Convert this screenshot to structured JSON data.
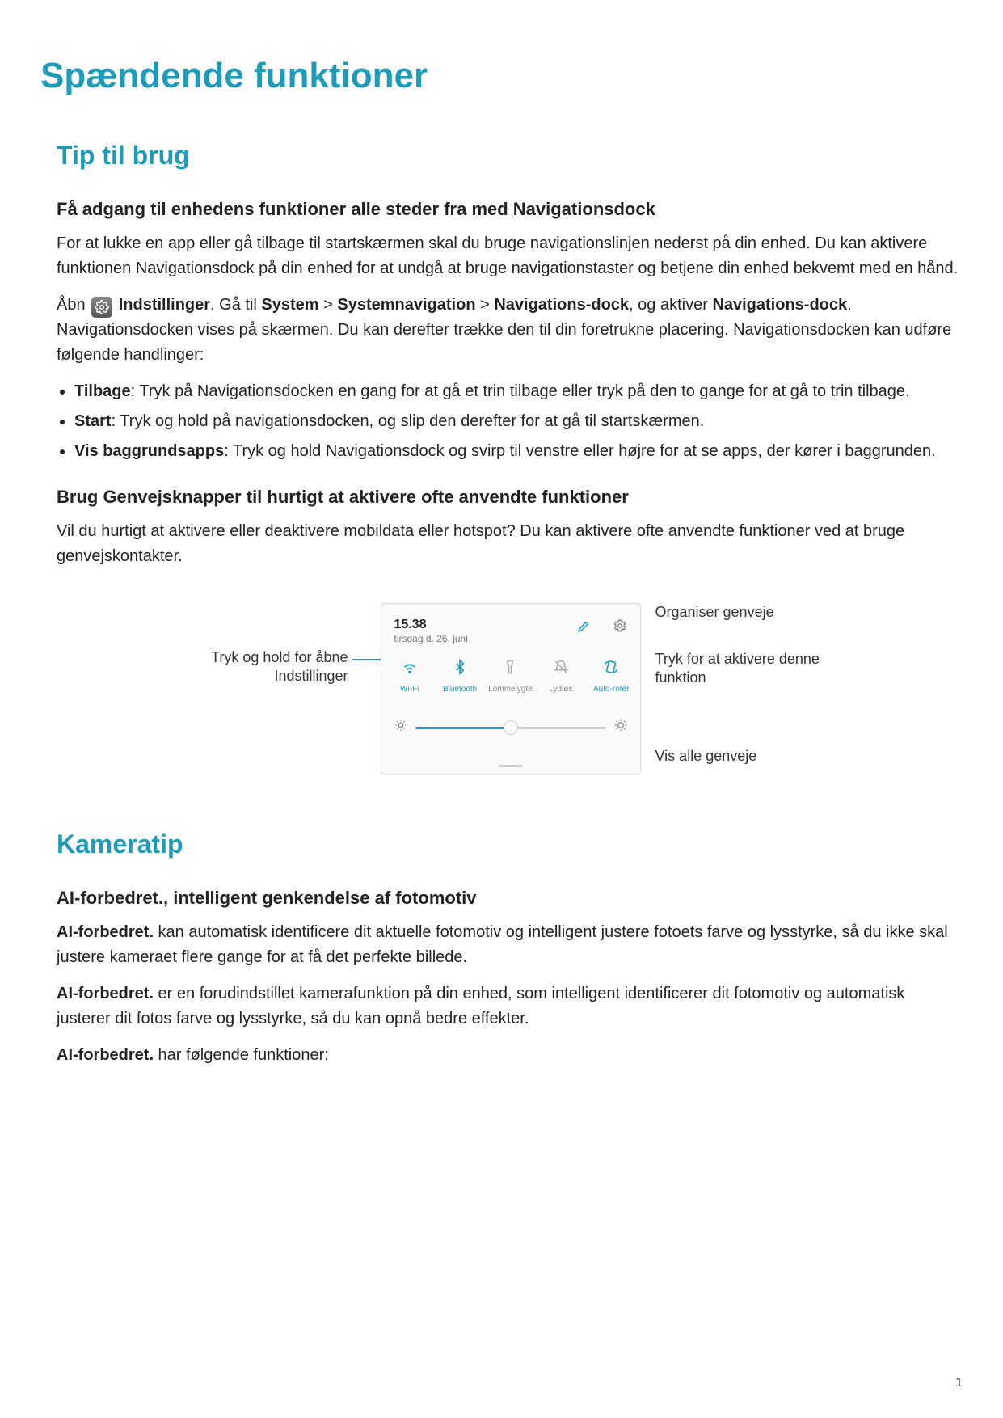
{
  "page_title": "Spændende funktioner",
  "section1": {
    "heading": "Tip til brug",
    "sub1_heading": "Få adgang til enhedens funktioner alle steder fra med Navigationsdock",
    "intro_p": "For at lukke en app eller gå tilbage til startskærmen skal du bruge navigationslinjen nederst på din enhed. Du kan aktivere funktionen Navigationsdock på din enhed for at undgå at bruge navigationstaster og betjene din enhed bekvemt med en hånd.",
    "open_prefix": "Åbn ",
    "open_app": "Indstillinger",
    "open_text_a": ". Gå til ",
    "path_system": "System",
    "sep": " > ",
    "path_sysnav": "Systemnavigation",
    "path_navdock": "Navigations-dock",
    "open_text_b": ", og aktiver ",
    "navdock_bold": "Navigations-dock",
    "open_text_c": ". Navigationsdocken vises på skærmen. Du kan derefter trække den til din foretrukne placering. Navigationsdocken kan udføre følgende handlinger:",
    "bul1_b": "Tilbage",
    "bul1_t": ": Tryk på Navigationsdocken en gang for at gå et trin tilbage eller tryk på den to gange for at gå to trin tilbage.",
    "bul2_b": "Start",
    "bul2_t": ": Tryk og hold på navigationsdocken, og slip den derefter for at gå til startskærmen.",
    "bul3_b": "Vis baggrundsapps",
    "bul3_t": ": Tryk og hold Navigationsdock og svirp til venstre eller højre for at se apps, der kører i baggrunden.",
    "sub2_heading": "Brug Genvejsknapper til hurtigt at aktivere ofte anvendte funktioner",
    "sub2_p": "Vil du hurtigt at aktivere eller deaktivere mobildata eller hotspot? Du kan aktivere ofte anvendte funktioner ved at bruge genvejskontakter."
  },
  "diagram": {
    "time": "15.38",
    "date": "tirsdag d. 26. juni",
    "tiles": {
      "wifi": "Wi-Fi",
      "bt": "Bluetooth",
      "flash": "Lommelygte",
      "silent": "Lydløs",
      "autorot": "Auto-rotér"
    },
    "callouts": {
      "left1": "Tryk og hold for åbne Indstillinger",
      "right1": "Organiser genveje",
      "right2": "Tryk for at aktivere denne funktion",
      "right3": "Vis alle genveje"
    }
  },
  "section2": {
    "heading": "Kameratip",
    "sub1_heading": "AI-forbedret., intelligent genkendelse af fotomotiv",
    "p1_b": "AI-forbedret.",
    "p1_t": " kan automatisk identificere dit aktuelle fotomotiv og intelligent justere fotoets farve og lysstyrke, så du ikke skal justere kameraet flere gange for at få det perfekte billede.",
    "p2_b": "AI-forbedret.",
    "p2_t": " er en forudindstillet kamerafunktion på din enhed, som intelligent identificerer dit fotomotiv og automatisk justerer dit fotos farve og lysstyrke, så du kan opnå bedre effekter.",
    "p3_b": "AI-forbedret.",
    "p3_t": " har følgende funktioner:"
  },
  "pagenum": "1"
}
